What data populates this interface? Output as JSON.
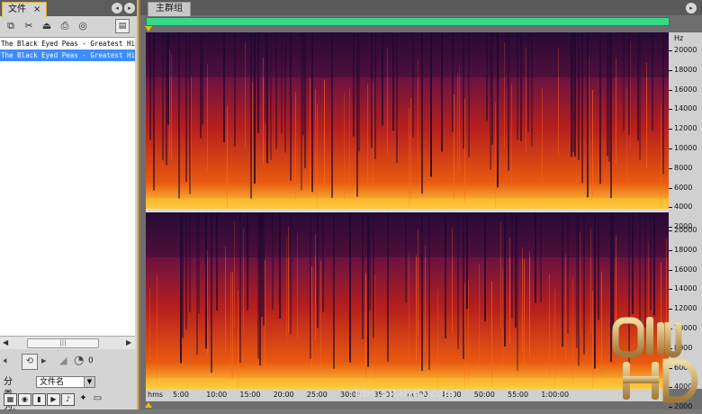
{
  "file_panel": {
    "tab_label": "文件",
    "close_glyph": "×",
    "files": [
      {
        "name": "The Black Eyed Peas - Greatest Hits",
        "selected": false
      },
      {
        "name": "The Black Eyed Peas - Greatest Hits",
        "selected": true
      }
    ],
    "sort_label": "分类为:",
    "sort_value": "文件名"
  },
  "main_panel": {
    "tab_label": "主群组",
    "freq_unit": "Hz",
    "freq_ticks": [
      "20000",
      "18000",
      "16000",
      "14000",
      "12000",
      "10000",
      "8000",
      "6000",
      "4000",
      "2000"
    ],
    "time_unit": "hms",
    "time_ticks": [
      "5:00",
      "10:00",
      "15:00",
      "20:00",
      "25:00",
      "30:00",
      "35:00",
      "40:00",
      "45:00",
      "50:00",
      "55:00",
      "1:00:00"
    ]
  },
  "watermark": {
    "text": "bbs.SILUHD.com",
    "logo_text": "SILU HD"
  },
  "colors": {
    "accent": "#e0b030",
    "overview": "#35d98a",
    "selection": "#3c8cff",
    "playhead": "#e8c000"
  }
}
